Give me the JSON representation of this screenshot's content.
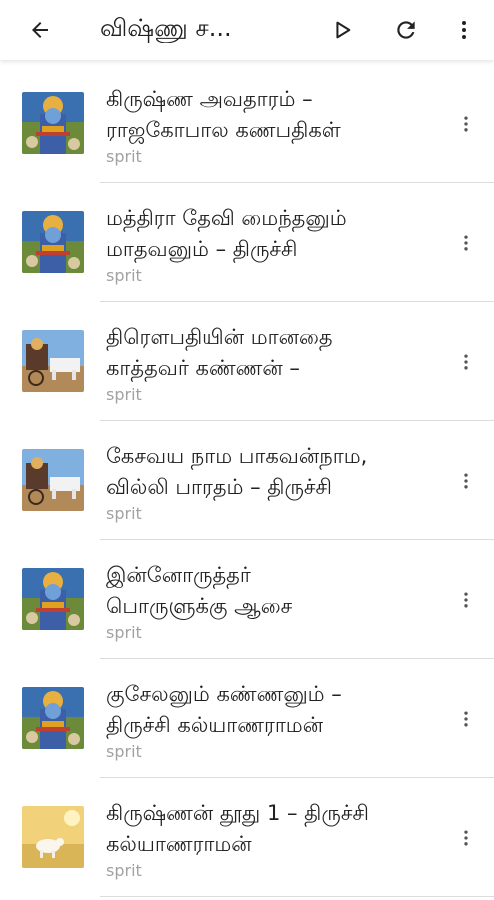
{
  "appbar": {
    "title": "விஷ்ணு ச...",
    "back_icon": "arrow-left-icon",
    "play_icon": "play-icon",
    "refresh_icon": "refresh-icon",
    "more_icon": "more-vert-icon"
  },
  "items": [
    {
      "line1": "கிருஷ்ண அவதாரம் –",
      "line2": "ராஜகோபால கணபதிகள்",
      "artist": "sprit",
      "thumb": "krishna"
    },
    {
      "line1": "மத்திரா தேவி மைந்தனும்",
      "line2": "மாதவனும் – திருச்சி",
      "artist": "sprit",
      "thumb": "krishna"
    },
    {
      "line1": "திரெளபதியின் மானதை",
      "line2": "காத்தவர் கண்ணன் –",
      "artist": "sprit",
      "thumb": "chariot"
    },
    {
      "line1": "கேசவய நாம பாகவன்நாம,",
      "line2": "வில்லி பாரதம் – திருச்சி",
      "artist": "sprit",
      "thumb": "chariot"
    },
    {
      "line1": "இன்னோருத்தர்",
      "line2": "பொருளுக்கு ஆசை",
      "artist": "sprit",
      "thumb": "krishna"
    },
    {
      "line1": "குசேலனும் கண்ணனும் –",
      "line2": "திருச்சி கல்யாணராமன்",
      "artist": "sprit",
      "thumb": "krishna"
    },
    {
      "line1": "கிருஷ்ணன் தூது 1 – திருச்சி",
      "line2": "கல்யாணராமன்",
      "artist": "sprit",
      "thumb": "cow"
    }
  ]
}
